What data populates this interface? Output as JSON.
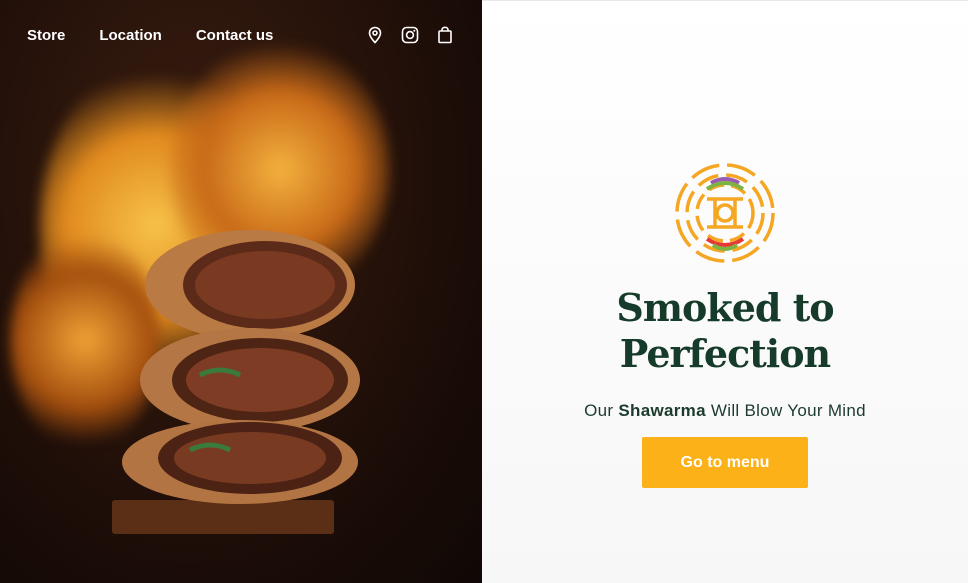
{
  "nav": {
    "links": [
      "Store",
      "Location",
      "Contact us"
    ],
    "icons": [
      "location-pin-icon",
      "instagram-icon",
      "shopping-bag-icon"
    ]
  },
  "hero": {
    "title_line1": "Smoked to",
    "title_line2": "Perfection",
    "tagline_prefix": "Our",
    "tagline_bold": "Shawarma",
    "tagline_suffix": "Will Blow Your Mind",
    "cta_label": "Go to menu"
  },
  "colors": {
    "accent": "#fbb117",
    "title": "#163b2a",
    "logo_orange": "#f5a623"
  }
}
